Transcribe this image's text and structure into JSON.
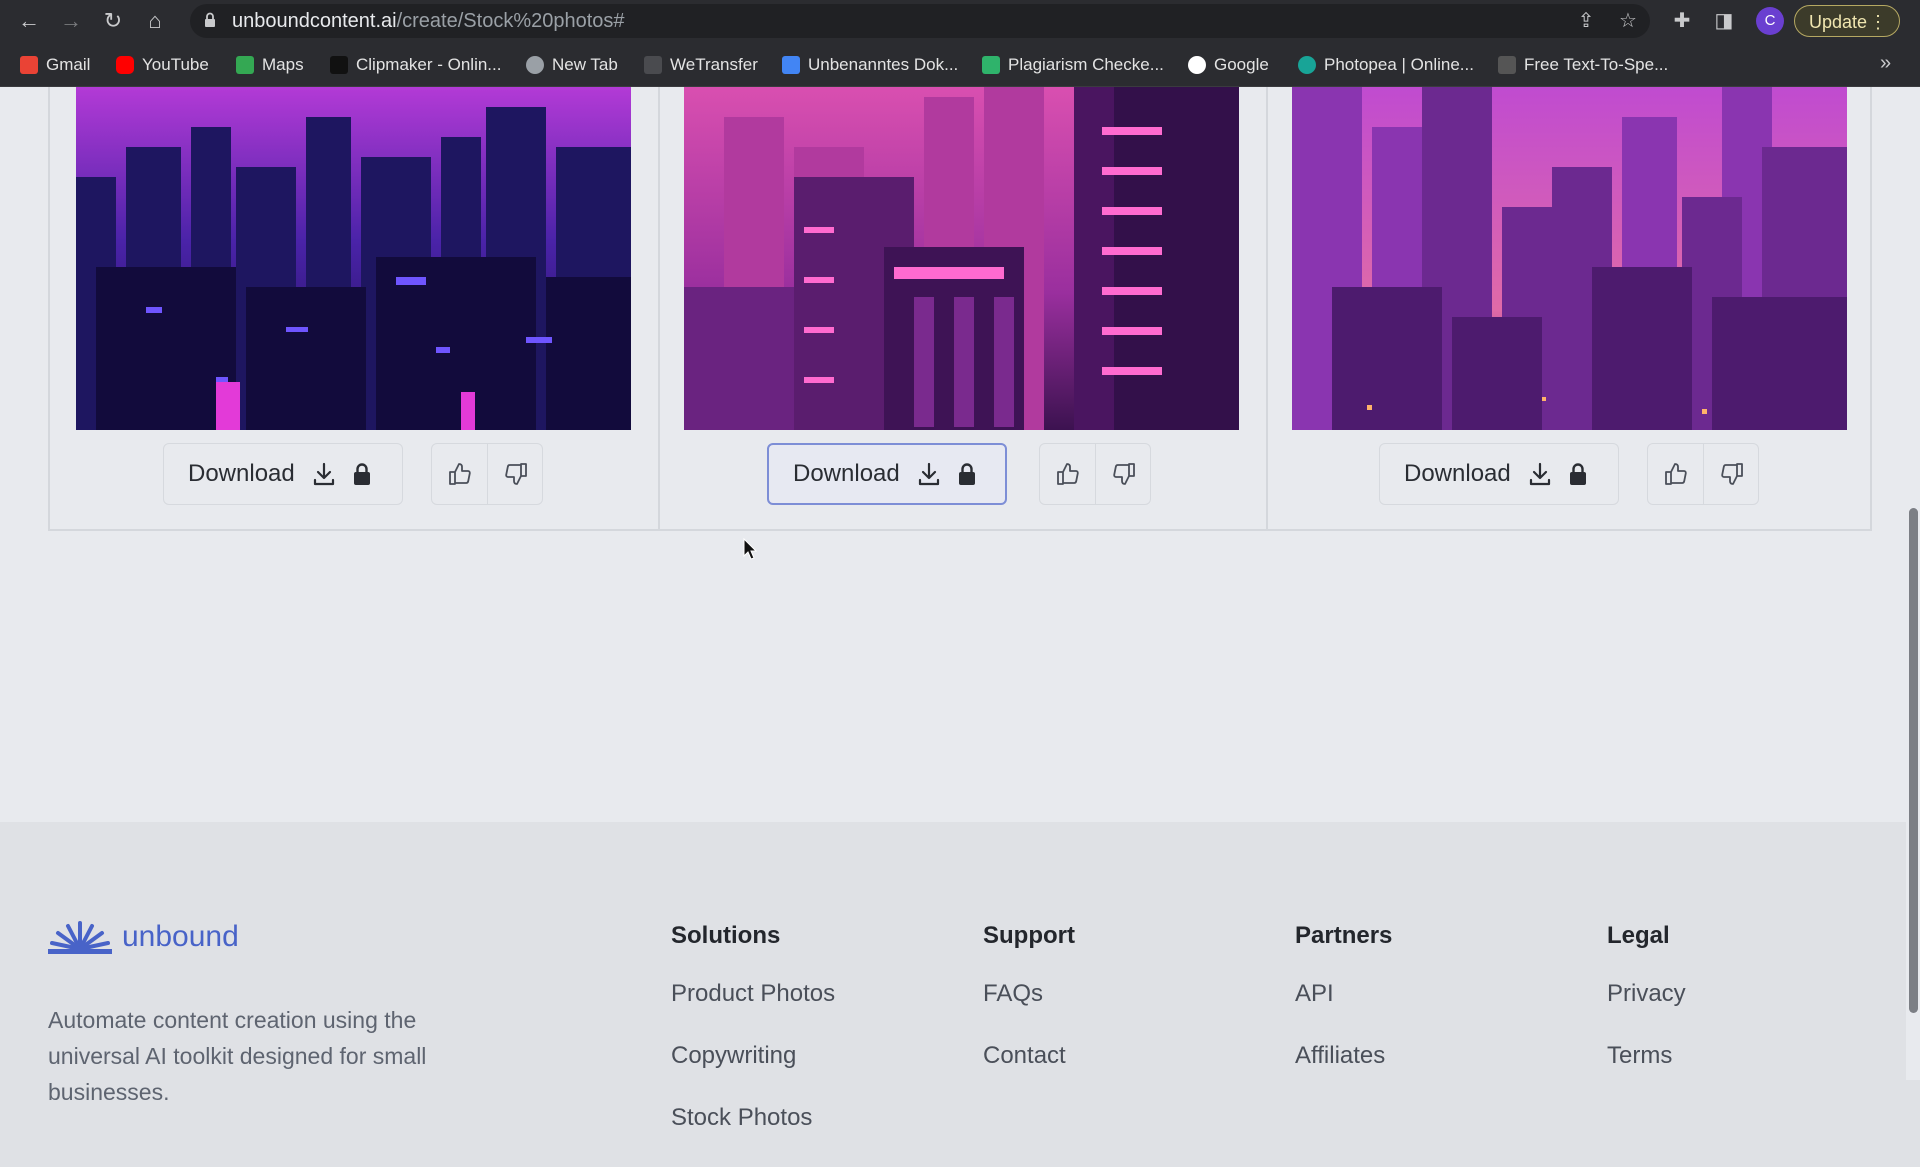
{
  "browser": {
    "url_host": "unboundcontent.ai",
    "url_path": "/create/Stock%20photos#",
    "profile_initial": "C",
    "update_label": "Update",
    "update_menu": "⋮",
    "bookmarks_more": "»",
    "bookmarks": [
      {
        "label": "Gmail",
        "color": "#ea4335"
      },
      {
        "label": "YouTube",
        "color": "#ff0000"
      },
      {
        "label": "Maps",
        "color": "#34a853"
      },
      {
        "label": "Clipmaker - Onlin...",
        "color": "#222222"
      },
      {
        "label": "New Tab",
        "color": "#9aa0a6"
      },
      {
        "label": "WeTransfer",
        "color": "#3a3b3e"
      },
      {
        "label": "Unbenanntes Dok...",
        "color": "#4285f4"
      },
      {
        "label": "Plagiarism Checke...",
        "color": "#2fb36b"
      },
      {
        "label": "Google",
        "color": "#ffffff"
      },
      {
        "label": "Photopea | Online...",
        "color": "#18a497"
      },
      {
        "label": "Free Text-To-Spe...",
        "color": "#555555"
      }
    ]
  },
  "gallery": {
    "download_label": "Download",
    "cards": [
      {
        "image": "purple-neon-city-night"
      },
      {
        "image": "pink-neon-skyscrapers"
      },
      {
        "image": "magenta-sunset-skyline"
      }
    ]
  },
  "footer": {
    "brand": "unbound",
    "tagline": "Automate content creation using the universal AI toolkit designed for small businesses.",
    "columns": [
      {
        "heading": "Solutions",
        "links": [
          "Product Photos",
          "Copywriting",
          "Stock Photos"
        ]
      },
      {
        "heading": "Support",
        "links": [
          "FAQs",
          "Contact"
        ]
      },
      {
        "heading": "Partners",
        "links": [
          "API",
          "Affiliates"
        ]
      },
      {
        "heading": "Legal",
        "links": [
          "Privacy",
          "Terms"
        ]
      }
    ],
    "accent_color": "#4863c8"
  }
}
